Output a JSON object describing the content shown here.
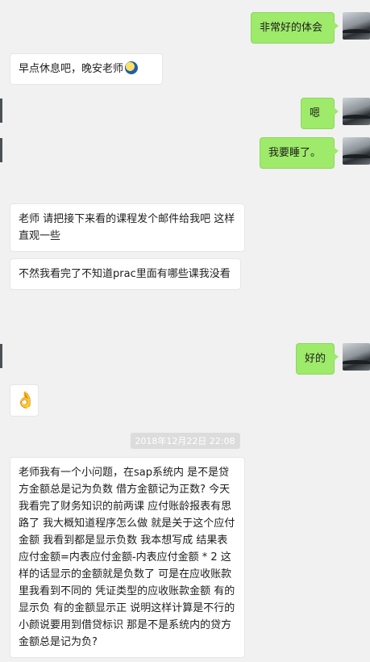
{
  "messages": [
    {
      "side": "out",
      "text": "非常好的体会"
    },
    {
      "side": "in",
      "text": "早点休息吧，晚安老师",
      "emoji": "moon-emoji"
    },
    {
      "side": "out",
      "text": "嗯"
    },
    {
      "side": "out",
      "text": "我要睡了。"
    },
    {
      "side": "in",
      "text": "老师 请把接下来看的课程发个邮件给我吧 这样直观一些"
    },
    {
      "side": "in",
      "text": "不然我看完了不知道prac里面有哪些课我没看"
    },
    {
      "side": "out",
      "text": "好的"
    },
    {
      "side": "in",
      "text": "👌",
      "emoji": "ok-hand-emoji"
    },
    {
      "side": "in",
      "text": "老师我有一个小问题，在sap系统内 是不是贷方金额总是记为负数 借方金额记为正数? 今天我看完了财务知识的前两课 应付账龄报表有思路了 我大概知道程序怎么做 就是关于这个应付金额 我看到都是显示负数 我本想写成   结果表应付金额=内表应付金额-内表应付金额 * 2  这样的话显示的金额就是负数了 可是在应收账款里我看到不同的 凭证类型的应收账款金额 有的显示负 有的金额显示正 说明这样计算是不行的 小颜说要用到借贷标识    那是不是系统内的贷方金额总是记为负?"
    }
  ],
  "timestamp": "2018年12月22日 22:08",
  "colors": {
    "outgoing_bubble": "#9eea6a",
    "incoming_bubble": "#ffffff",
    "background": "#f1f1f1"
  }
}
